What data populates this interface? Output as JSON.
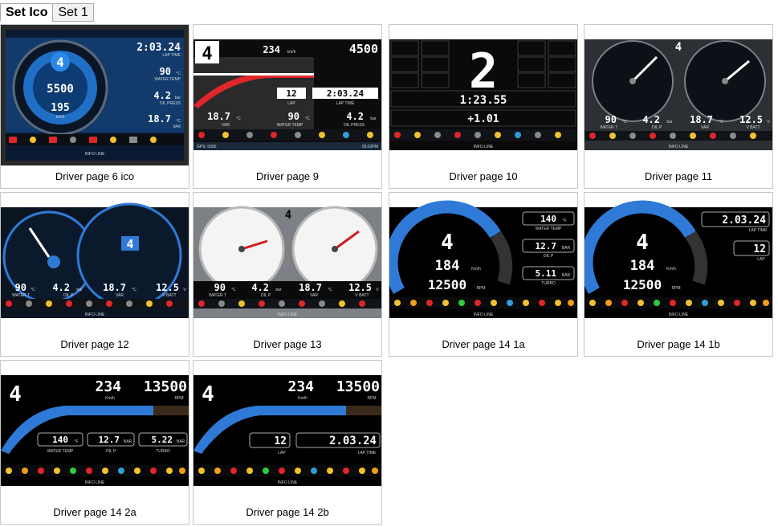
{
  "tabs": [
    {
      "label": "Set Ico",
      "active": true
    },
    {
      "label": "Set 1",
      "active": false
    }
  ],
  "cards": [
    {
      "caption": "Driver page 6 ico",
      "values": {
        "gear": "4",
        "rpm": "5500",
        "speed": "195",
        "speed_unit": "km/h",
        "lap_time": "2:03.24",
        "lap_time_label": "LAP TIME",
        "water_temp": "90",
        "water_temp_unit": "°C",
        "water_temp_label": "WATER TEMP",
        "oil_press": "4.2",
        "oil_press_unit": "bar",
        "oil_press_label": "OIL PRESS",
        "var": "18.7",
        "var_unit": "°C",
        "var_label": "VAR",
        "info_line": "INFO LINE"
      }
    },
    {
      "caption": "Driver page 9",
      "values": {
        "gear": "4",
        "speed": "234",
        "speed_unit": "km/h",
        "rpm": "4500",
        "lap": "12",
        "lap_label": "LAP",
        "lap_time": "2:03.24",
        "lap_time_label": "LAP TIME",
        "var": "18.7",
        "var_unit": "°C",
        "var_label": "VAR",
        "water_temp": "90",
        "water_temp_unit": "°C",
        "water_temp_label": "WATER TEMP",
        "oil_press": "4.2",
        "oil_press_unit": "bar",
        "oil_press_label": "OIL PRESS",
        "gps": "GPS: 0000",
        "clock": "05:03PM"
      }
    },
    {
      "caption": "Driver page 10",
      "values": {
        "gear": "2",
        "lap_time": "1:23.55",
        "delta": "+1.01",
        "info_line": "INFO LINE"
      }
    },
    {
      "caption": "Driver page 11",
      "values": {
        "gear": "4",
        "water_temp": "90",
        "water_temp_unit": "°C",
        "water_temp_label": "WATER T",
        "oil_press": "4.2",
        "oil_press_unit": "bar",
        "oil_press_label": "OIL P",
        "var": "18.7",
        "var_unit": "°C",
        "var_label": "VAR",
        "v_batt": "12.5",
        "v_batt_unit": "V",
        "v_batt_label": "V BATT",
        "info_line": "INFO LINE"
      }
    },
    {
      "caption": "Driver page 12",
      "values": {
        "gear": "4",
        "water_temp": "90",
        "water_temp_unit": "°C",
        "water_temp_label": "WATER T",
        "oil_press": "4.2",
        "oil_press_unit": "bar",
        "oil_press_label": "OIL P",
        "var": "18.7",
        "var_unit": "°C",
        "var_label": "VAR",
        "v_batt": "12.5",
        "v_batt_unit": "V",
        "v_batt_label": "V BATT",
        "info_line": "INFO LINE"
      }
    },
    {
      "caption": "Driver page 13",
      "values": {
        "gear": "4",
        "water_temp": "90",
        "water_temp_unit": "°C",
        "water_temp_label": "WATER T",
        "oil_press": "4.2",
        "oil_press_unit": "bar",
        "oil_press_label": "OIL P",
        "var": "18.7",
        "var_unit": "°C",
        "var_label": "VAR",
        "v_batt": "12.5",
        "v_batt_unit": "V",
        "v_batt_label": "V BATT",
        "info_line": "INFO LINE"
      }
    },
    {
      "caption": "Driver page 14 1a",
      "values": {
        "gear": "4",
        "speed": "184",
        "speed_unit": "Km/h",
        "rpm": "12500",
        "rpm_unit": "RPM",
        "water_temp": "140",
        "water_temp_unit": "°F",
        "water_temp_label": "WATER TEMP",
        "oil_press": "12.7",
        "oil_press_unit": "BAR",
        "oil_press_label": "OIL P",
        "turbo": "5.11",
        "turbo_unit": "BAR",
        "turbo_label": "TURBO",
        "info_line": "INFO LINE"
      }
    },
    {
      "caption": "Driver page 14 1b",
      "values": {
        "gear": "4",
        "speed": "184",
        "speed_unit": "Km/h",
        "rpm": "12500",
        "rpm_unit": "RPM",
        "lap_time": "2.03.24",
        "lap_time_label": "LAP TIME",
        "lap": "12",
        "lap_label": "LAP",
        "info_line": "INFO LINE"
      }
    },
    {
      "caption": "Driver page 14 2a",
      "values": {
        "gear": "4",
        "speed": "234",
        "speed_unit": "Km/h",
        "rpm": "13500",
        "rpm_unit": "RPM",
        "water_temp": "140",
        "water_temp_unit": "°F",
        "water_temp_label": "WATER TEMP",
        "oil_press": "12.7",
        "oil_press_unit": "BAR",
        "oil_press_label": "OIL P",
        "turbo": "5.22",
        "turbo_unit": "BAR",
        "turbo_label": "TURBO",
        "info_line": "INFO LINE"
      }
    },
    {
      "caption": "Driver page 14 2b",
      "values": {
        "gear": "4",
        "speed": "234",
        "speed_unit": "Km/h",
        "rpm": "13500",
        "rpm_unit": "RPM",
        "lap": "12",
        "lap_label": "LAP",
        "lap_time": "2.03.24",
        "lap_time_label": "LAP TIME",
        "info_line": "INFO LINE"
      }
    }
  ],
  "colors": {
    "accent_blue": "#2f7ad6",
    "dash_bg": "#0b0f14",
    "warning_yellow": "#f2c12e",
    "warning_red": "#e0262b"
  }
}
